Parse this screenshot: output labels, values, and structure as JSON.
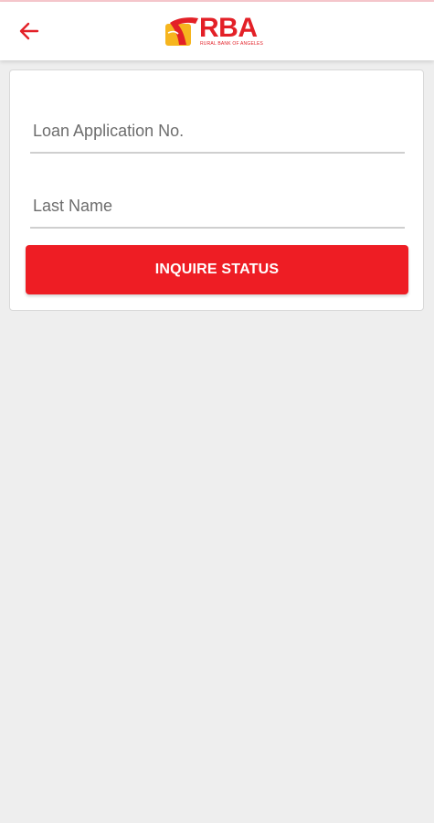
{
  "app_bar": {
    "back_icon": "arrow-left-icon",
    "logo_text": "RBA",
    "logo_subtext": "RURAL BANK OF ANGELES",
    "logo_icon": "rba-mark-icon"
  },
  "form": {
    "loan_application_placeholder": "Loan Application No.",
    "loan_application_value": "",
    "last_name_placeholder": "Last Name",
    "last_name_value": "",
    "submit_label": "INQUIRE STATUS"
  },
  "colors": {
    "accent_red": "#ee1d24",
    "logo_yellow": "#f6b51e",
    "background": "#eeeeee",
    "card": "#ffffff"
  }
}
